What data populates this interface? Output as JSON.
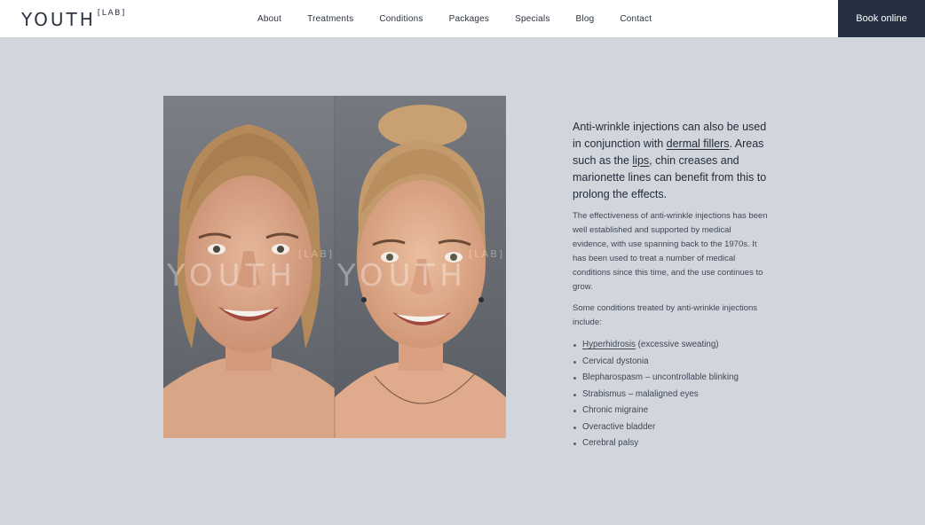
{
  "brand": {
    "name": "YOUTH",
    "suffix": "[LAB]"
  },
  "nav": {
    "items": [
      {
        "label": "About"
      },
      {
        "label": "Treatments"
      },
      {
        "label": "Conditions"
      },
      {
        "label": "Packages"
      },
      {
        "label": "Specials"
      },
      {
        "label": "Blog"
      },
      {
        "label": "Contact"
      }
    ],
    "cta_label": "Book online"
  },
  "image": {
    "watermark_left": "YOUTH",
    "watermark_right": "YOUTH",
    "watermark_suffix": "[LAB]"
  },
  "content": {
    "lead": {
      "t1": "Anti-wrinkle injections can also be used in conjunction with ",
      "link1": "dermal fillers",
      "t2": ". Areas such as the ",
      "link2": "lips",
      "t3": ", chin creases and marionette lines can benefit from this to prolong the effects."
    },
    "paragraph1": "The effectiveness of anti-wrinkle injections has been well established and supported by medical evidence, with use spanning back to the 1970s. It has been used to treat a number of medical conditions since this time, and the use continues to grow.",
    "paragraph2": "Some conditions treated by anti-wrinkle injections include:",
    "conditions": [
      {
        "link": "Hyperhidrosis",
        "text": " (excessive sweating)"
      },
      {
        "text": "Cervical dystonia"
      },
      {
        "text": "Blepharospasm – uncontrollable blinking"
      },
      {
        "text": "Strabismus – malaligned eyes"
      },
      {
        "text": "Chronic migraine"
      },
      {
        "text": "Overactive bladder"
      },
      {
        "text": "Cerebral palsy"
      }
    ]
  },
  "colors": {
    "page_background": "#d2d5dc",
    "header_background": "#ffffff",
    "cta_background": "#253042",
    "text": "#2b3240"
  }
}
